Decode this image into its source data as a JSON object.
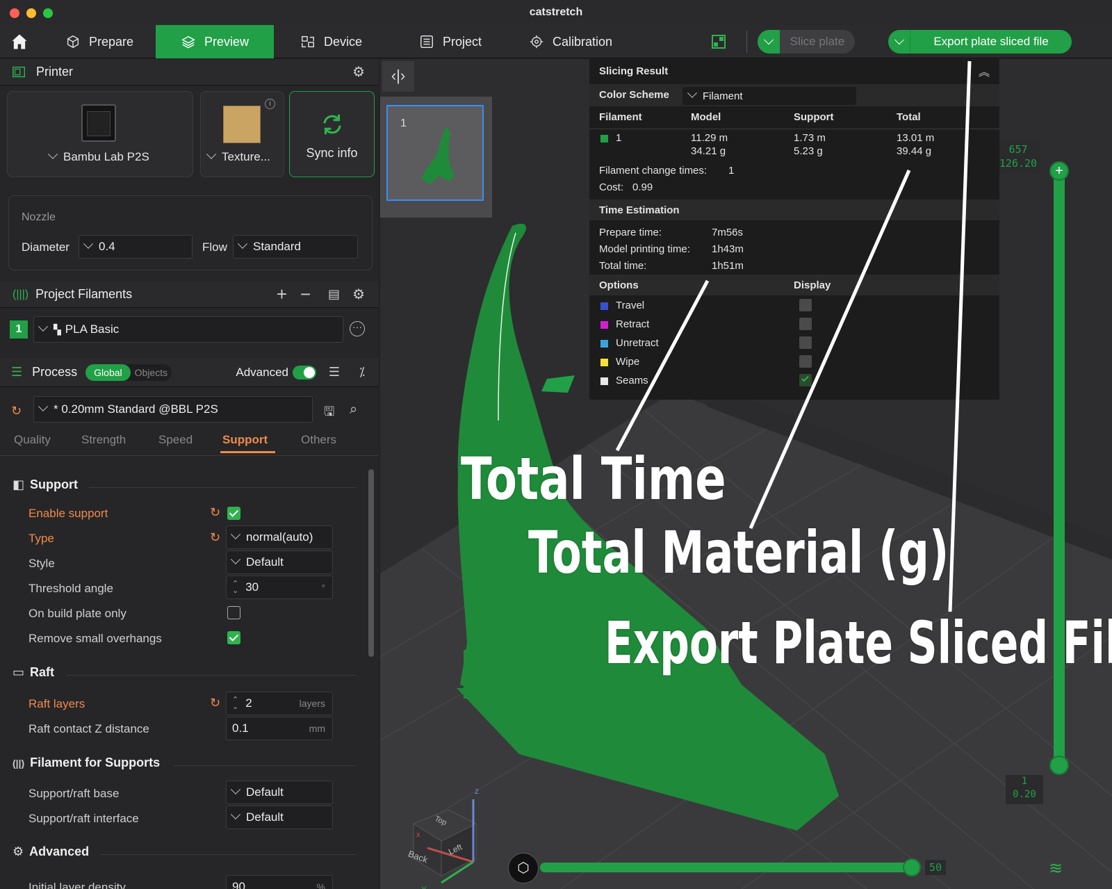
{
  "window": {
    "title": "catstretch"
  },
  "menu": {
    "tabs": [
      {
        "label": "Prepare"
      },
      {
        "label": "Preview"
      },
      {
        "label": "Device"
      },
      {
        "label": "Project"
      },
      {
        "label": "Calibration"
      }
    ],
    "slice_plate": "Slice plate",
    "export_plate": "Export plate sliced file"
  },
  "printer": {
    "title": "Printer",
    "model": "Bambu Lab P2S",
    "plate": "Texture...",
    "sync": "Sync info"
  },
  "nozzle": {
    "title": "Nozzle",
    "diameter_label": "Diameter",
    "diameter": "0.4",
    "flow_label": "Flow",
    "flow": "Standard"
  },
  "filaments": {
    "title": "Project Filaments",
    "items": [
      {
        "index": "1",
        "name": "PLA Basic"
      }
    ]
  },
  "process": {
    "title": "Process",
    "global": "Global",
    "objects": "Objects",
    "advanced": "Advanced",
    "preset": "* 0.20mm Standard @BBL P2S",
    "tabs": [
      "Quality",
      "Strength",
      "Speed",
      "Support",
      "Others"
    ]
  },
  "support": {
    "title": "Support",
    "enable": "Enable support",
    "type_label": "Type",
    "type": "normal(auto)",
    "style_label": "Style",
    "style": "Default",
    "threshold_label": "Threshold angle",
    "threshold": "30",
    "threshold_unit": "°",
    "build_plate_only": "On build plate only",
    "remove_small": "Remove small overhangs"
  },
  "raft": {
    "title": "Raft",
    "layers_label": "Raft layers",
    "layers": "2",
    "layers_unit": "layers",
    "contact_label": "Raft contact Z distance",
    "contact": "0.1",
    "contact_unit": "mm"
  },
  "filament_supports": {
    "title": "Filament for Supports",
    "base_label": "Support/raft base",
    "base": "Default",
    "interface_label": "Support/raft interface",
    "interface": "Default"
  },
  "advanced": {
    "title": "Advanced",
    "density_label": "Initial layer density",
    "density": "90",
    "density_unit": "%"
  },
  "plate_thumb": {
    "number": "1"
  },
  "slicing": {
    "title": "Slicing Result",
    "scheme_label": "Color Scheme",
    "scheme": "Filament",
    "headers": [
      "Filament",
      "Model",
      "Support",
      "Total"
    ],
    "filament": {
      "id": "1",
      "model_m": "11.29 m",
      "model_g": "34.21 g",
      "support_m": "1.73 m",
      "support_g": "5.23 g",
      "total_m": "13.01 m",
      "total_g": "39.44 g"
    },
    "change_times_label": "Filament change times:",
    "change_times": "1",
    "cost_label": "Cost:",
    "cost": "0.99",
    "time_title": "Time Estimation",
    "prepare_label": "Prepare time:",
    "prepare": "7m56s",
    "model_label": "Model printing time:",
    "model": "1h43m",
    "total_label": "Total time:",
    "total": "1h51m",
    "options_title": "Options",
    "display_title": "Display",
    "options": [
      {
        "label": "Travel",
        "color": "#3a4fd0"
      },
      {
        "label": "Retract",
        "color": "#d41ed4"
      },
      {
        "label": "Unretract",
        "color": "#3aa4e0"
      },
      {
        "label": "Wipe",
        "color": "#f2e33a"
      },
      {
        "label": "Seams",
        "color": "#e8e8e8"
      }
    ]
  },
  "layer_slider": {
    "top_layer": "657",
    "top_height": "126.20",
    "bottom_layer": "1",
    "bottom_height": "0.20"
  },
  "move_slider": {
    "value": "50"
  },
  "axes": {
    "top": "Top",
    "back": "Back",
    "left": "Left",
    "x": "x",
    "y": "y",
    "z": "z"
  },
  "annotations": {
    "total_time": "Total Time",
    "total_material": "Total Material (g)",
    "export": "Export Plate Sliced File"
  },
  "colors": {
    "accent": "#21a047",
    "orange": "#f08a4b",
    "model": "#1f8a3a"
  }
}
